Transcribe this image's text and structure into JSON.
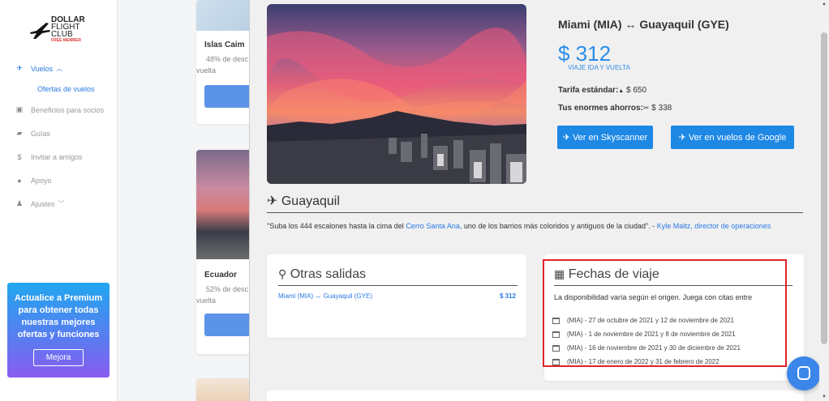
{
  "brand": {
    "line1": "DOLLAR",
    "line2": "FLIGHT",
    "line3": "CLUB",
    "line4": "FREE MEMBER"
  },
  "sidebar": {
    "items": [
      {
        "label": "Vuelos",
        "icon": "airplane-icon"
      },
      {
        "label": "Ofertas de vuelos"
      },
      {
        "label": "Beneficios para socios",
        "icon": "camera-icon"
      },
      {
        "label": "Guías",
        "icon": "book-icon"
      },
      {
        "label": "Invitar a amigos",
        "icon": "dollar-icon"
      },
      {
        "label": "Apoyo",
        "icon": "help-icon"
      },
      {
        "label": "Ajustes",
        "icon": "user-icon"
      }
    ]
  },
  "premium": {
    "text": "Actualice a Premium para obtener todas nuestras mejores ofertas y funciones",
    "button": "Mejora"
  },
  "bg_cards": [
    {
      "title": "Islas Caim",
      "desc1": "48% de desc",
      "desc2": "vuelta"
    },
    {
      "title": "Ecuador",
      "desc1": "52% de desc",
      "desc2": "vuelta"
    }
  ],
  "deal": {
    "route": "Miami (MIA) ↔ Guayaquil (GYE)",
    "price": "$ 312",
    "price_note": "VIAJE IDA Y VUELTA",
    "standard_label": "Tarifa estándar:",
    "standard_value": "$ 650",
    "savings_label": "Tus enormes ahorros:",
    "savings_value": "$ 338",
    "btn_skyscanner": "Ver en Skyscanner",
    "btn_google": "Ver en vuelos de Google"
  },
  "city": {
    "name": "Guayaquil",
    "quote_a": "\"Suba los 444 escalones hasta la cima del ",
    "quote_link": "Cerro Santa Ana,",
    "quote_b": " uno de los barrios más coloridos y antiguos de la ciudad\". - ",
    "quote_author": "Kyle Maltz, director de operaciones"
  },
  "other_departures": {
    "title": "Otras salidas",
    "items": [
      {
        "route": "Miami (MIA) ↔ Guayaquil (GYE)",
        "price": "$ 312"
      }
    ]
  },
  "travel_dates": {
    "title": "Fechas de viaje",
    "note": "La disponibilidad varía según el origen. Juega con citas entre",
    "dates": [
      "(MIA) - 27 de octubre de 2021 y 12 de noviembre de 2021",
      "(MIA) - 1 de noviembre de 2021 y 8 de noviembre de 2021",
      "(MIA) - 16 de noviembre de 2021 y 30 de diciembre de 2021",
      "(MIA) - 17 de enero de 2022 y 31 de febrero de 2022"
    ]
  },
  "colors": {
    "accent": "#1e88e5",
    "highlight": "#e0242a"
  }
}
